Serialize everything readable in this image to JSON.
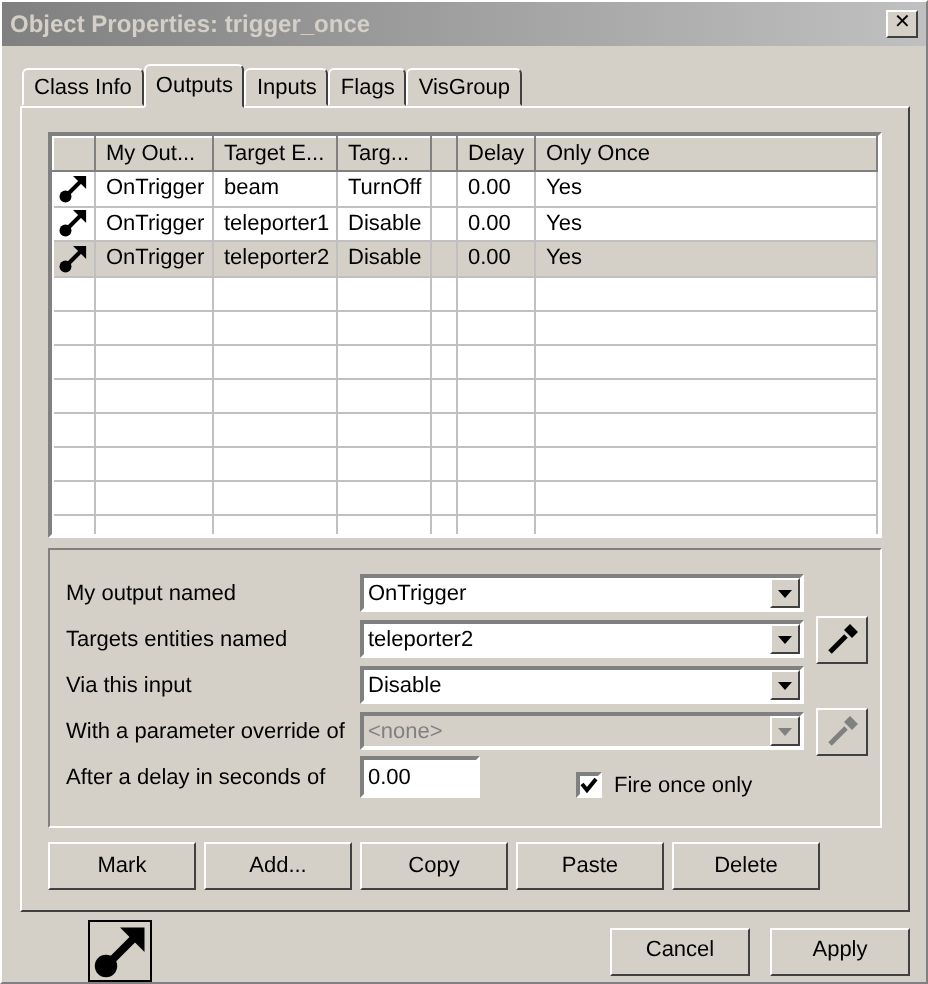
{
  "window": {
    "title": "Object Properties: trigger_once",
    "close": "✕"
  },
  "tabs": [
    {
      "label": "Class Info",
      "selected": false
    },
    {
      "label": "Outputs",
      "selected": true
    },
    {
      "label": "Inputs",
      "selected": false
    },
    {
      "label": "Flags",
      "selected": false
    },
    {
      "label": "VisGroup",
      "selected": false
    }
  ],
  "table": {
    "columns": [
      "My Out...",
      "Target E...",
      "Targ...",
      "Delay",
      "Only Once"
    ],
    "rows": [
      {
        "cells": [
          "OnTrigger",
          "beam",
          "TurnOff",
          "0.00",
          "Yes"
        ],
        "selected": false
      },
      {
        "cells": [
          "OnTrigger",
          "teleporter1",
          "Disable",
          "0.00",
          "Yes"
        ],
        "selected": false
      },
      {
        "cells": [
          "OnTrigger",
          "teleporter2",
          "Disable",
          "0.00",
          "Yes"
        ],
        "selected": true
      }
    ]
  },
  "form": {
    "fields": [
      {
        "label": "My output named",
        "kind": "select",
        "value": "OnTrigger",
        "disabled": false,
        "picker": false
      },
      {
        "label": "Targets entities named",
        "kind": "select",
        "value": "teleporter2",
        "disabled": false,
        "picker": true
      },
      {
        "label": "Via this input",
        "kind": "select",
        "value": "Disable",
        "disabled": false,
        "picker": false
      },
      {
        "label": "With a parameter override of",
        "kind": "select",
        "value": "<none>",
        "disabled": true,
        "picker": true
      },
      {
        "label": "After a delay in seconds of",
        "kind": "text",
        "value": "0.00",
        "disabled": false,
        "picker": false
      }
    ],
    "checkbox": {
      "label": "Fire once only",
      "checked": true
    }
  },
  "actions": [
    "Mark",
    "Add...",
    "Copy",
    "Paste",
    "Delete"
  ],
  "buttons": [
    "Cancel",
    "Apply"
  ]
}
